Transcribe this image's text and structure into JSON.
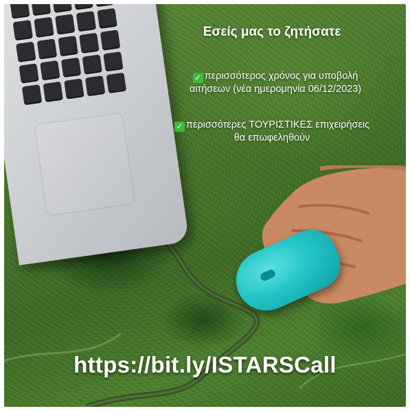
{
  "headline": "Εσείς μας το ζητήσατε",
  "bullets": [
    {
      "icon": "check-mark-icon",
      "line1": "περισσότερος χρόνος για υποβολή",
      "line2": "αιτήσεων (νέα ημερομηνία 06/12/2023)"
    },
    {
      "icon": "check-mark-icon",
      "line1": "περισσότερες ΤΟΥΡΙΣΤΙΚΕΣ επιχειρήσεις",
      "line2": "θα επωφεληθούν"
    }
  ],
  "link": "https://bit.ly/ISTARSCall",
  "colors": {
    "check_box": "#3cb93c",
    "mouse": "#22c4c6",
    "text": "#ffffff"
  }
}
